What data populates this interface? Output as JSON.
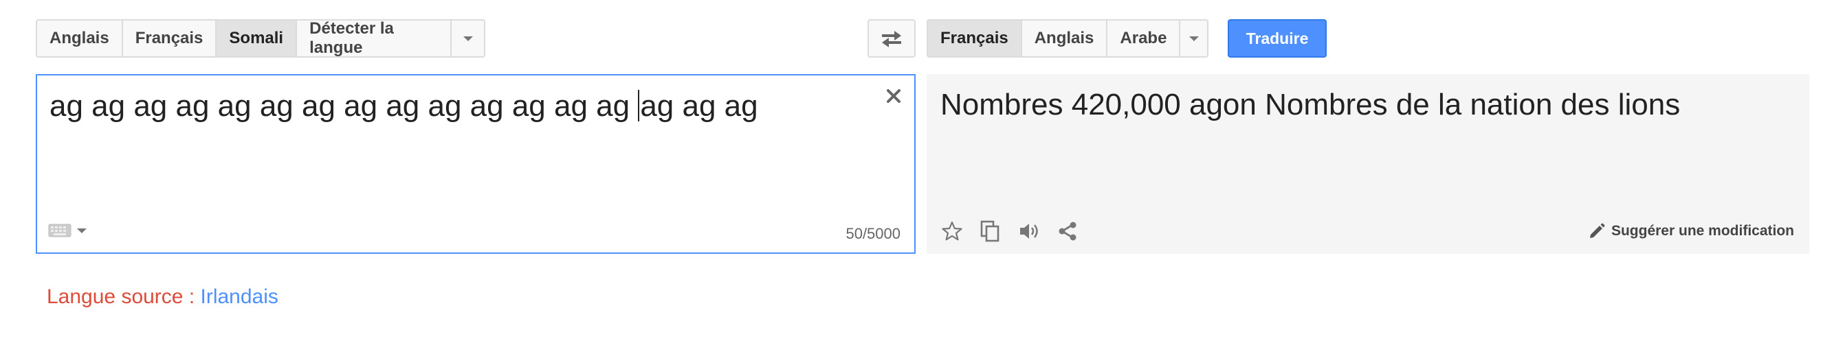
{
  "source_languages": {
    "items": [
      "Anglais",
      "Français",
      "Somali",
      "Détecter la langue"
    ],
    "selected": "Somali"
  },
  "target_languages": {
    "items": [
      "Français",
      "Anglais",
      "Arabe"
    ],
    "selected": "Français"
  },
  "translate_button": "Traduire",
  "source": {
    "text_before_cursor": "ag ag ag ag ag ag ag ag ag ag ag ag ag ag ",
    "text_after_cursor": "ag ag ag",
    "char_count": "50/5000"
  },
  "target": {
    "text": "Nombres 420,000 agon Nombres de la nation des lions",
    "suggest_label": "Suggérer une modification"
  },
  "source_language_info": {
    "label": "Langue source : ",
    "value": "Irlandais"
  },
  "icons": {
    "swap": "swap-languages-icon",
    "clear": "close-icon",
    "keyboard": "keyboard-icon",
    "star": "star-icon",
    "copy": "copy-icon",
    "speaker": "speaker-icon",
    "share": "share-icon",
    "pencil": "pencil-icon"
  },
  "colors": {
    "accent": "#4d90fe",
    "error_text": "#dd4b39",
    "panel_bg": "#f5f5f5"
  }
}
